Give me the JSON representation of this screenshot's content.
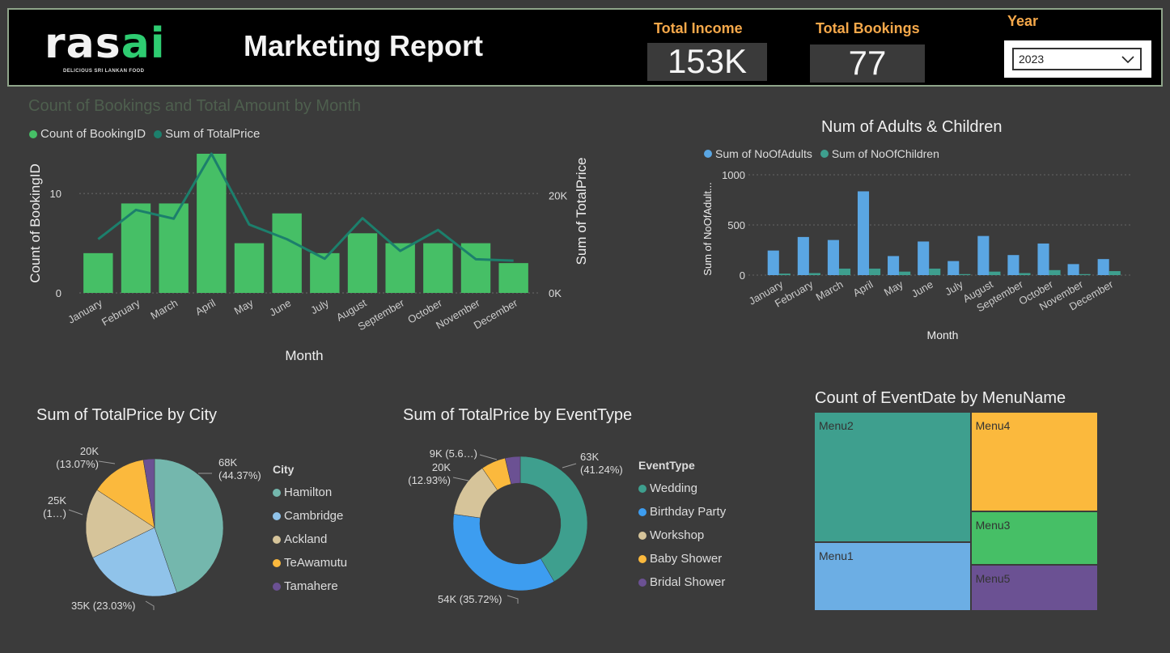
{
  "header": {
    "logo_main": "rasai",
    "logo_sub": "DELICIOUS SRI LANKAN FOOD",
    "title": "Marketing Report",
    "kpis": [
      {
        "label": "Total Income",
        "value": "153K"
      },
      {
        "label": "Total Bookings",
        "value": "77"
      }
    ],
    "year_label": "Year",
    "year_value": "2023"
  },
  "colors": {
    "green": "#46bf66",
    "line": "#1c7f6c",
    "blue": "#5aa6e3",
    "teal": "#3e9f8e",
    "hamilton": "#74b7ad",
    "cambridge": "#90c3ea",
    "ackland": "#d6c49a",
    "teawamutu": "#fbb93d",
    "tamahere": "#6b5193",
    "wedding": "#3e9f8e",
    "birthday": "#3d9df0",
    "workshop": "#d6c49a",
    "baby": "#fbb93d",
    "bridal": "#6b5193",
    "menu1": "#6caee4",
    "menu2": "#3e9f8e",
    "menu3": "#46bf66",
    "menu4": "#fbb93d",
    "menu5": "#6b5193"
  },
  "chart_data": [
    {
      "type": "bar",
      "title": "Count of Bookings and Total Amount by Month",
      "xlabel": "Month",
      "ylabel": "Count of BookingID",
      "y2label": "Sum of TotalPrice",
      "categories": [
        "January",
        "February",
        "March",
        "April",
        "May",
        "June",
        "July",
        "August",
        "September",
        "October",
        "November",
        "December"
      ],
      "series": [
        {
          "name": "Count of BookingID",
          "kind": "bar",
          "axis": "left",
          "values": [
            4,
            9,
            9,
            14,
            5,
            8,
            4,
            6,
            5,
            5,
            5,
            3
          ]
        },
        {
          "name": "Sum of TotalPrice",
          "kind": "line",
          "axis": "right",
          "values": [
            11000,
            17000,
            15200,
            28500,
            14000,
            11000,
            7000,
            15300,
            8600,
            12900,
            6900,
            6600
          ]
        }
      ],
      "ylim": [
        0,
        14
      ],
      "y2lim": [
        0,
        28500
      ],
      "yticks": [
        "0",
        "10"
      ],
      "y2ticks": [
        "0K",
        "20K"
      ],
      "grid": true,
      "legend": "top-left"
    },
    {
      "type": "bar",
      "title": "Num of Adults & Children",
      "xlabel": "Month",
      "ylabel": "Sum of NoOfAdult...",
      "categories": [
        "January",
        "February",
        "March",
        "April",
        "May",
        "June",
        "July",
        "August",
        "September",
        "October",
        "November",
        "December"
      ],
      "series": [
        {
          "name": "Sum of NoOfAdults",
          "values": [
            245,
            380,
            350,
            835,
            190,
            335,
            140,
            390,
            200,
            315,
            110,
            160
          ]
        },
        {
          "name": "Sum of NoOfChildren",
          "values": [
            15,
            20,
            65,
            65,
            35,
            65,
            10,
            35,
            20,
            50,
            10,
            40
          ]
        }
      ],
      "ylim": [
        0,
        1000
      ],
      "yticks": [
        "0",
        "500",
        "1000"
      ],
      "grid": true,
      "legend": "top-left"
    },
    {
      "type": "pie",
      "title": "Sum of TotalPrice by City",
      "legend_title": "City",
      "categories": [
        "Hamilton",
        "Cambridge",
        "Ackland",
        "TeAwamutu",
        "Tamahere"
      ],
      "values": [
        68000,
        35000,
        25000,
        20000,
        4000
      ],
      "data_labels": [
        "68K\n(44.37%)",
        "35K (23.03%)",
        "25K\n(1…)",
        "20K\n(13.07%)",
        ""
      ],
      "legend": "right"
    },
    {
      "type": "pie",
      "title": "Sum of TotalPrice by EventType",
      "legend_title": "EventType",
      "categories": [
        "Wedding",
        "Birthday Party",
        "Workshop",
        "Baby Shower",
        "Bridal Shower"
      ],
      "values": [
        63000,
        54000,
        20000,
        9000,
        5500
      ],
      "data_labels": [
        "63K\n(41.24%)",
        "54K (35.72%)",
        "20K\n(12.93%)",
        "9K (5.6…)",
        ""
      ],
      "donut": true,
      "legend": "right"
    },
    {
      "type": "treemap",
      "title": "Count of EventDate by MenuName",
      "categories": [
        "Menu2",
        "Menu1",
        "Menu4",
        "Menu3",
        "Menu5"
      ],
      "values": [
        21,
        11,
        13,
        7,
        6
      ]
    }
  ]
}
